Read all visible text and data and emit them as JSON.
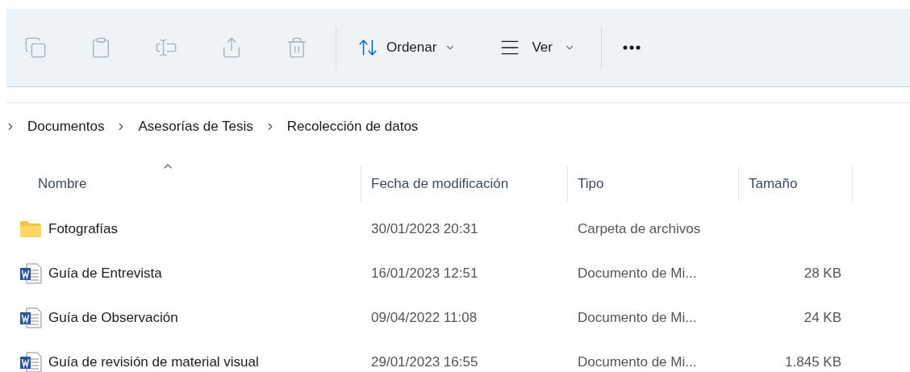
{
  "toolbar": {
    "actions": [
      {
        "kind": "copy",
        "disabled": true
      },
      {
        "kind": "paste",
        "disabled": true
      },
      {
        "kind": "rename",
        "disabled": true
      },
      {
        "kind": "share",
        "disabled": true
      },
      {
        "kind": "delete",
        "disabled": true
      }
    ],
    "sort_button": {
      "label": "Ordenar"
    },
    "view_button": {
      "label": "Ver"
    }
  },
  "breadcrumb": [
    "Documentos",
    "Asesorías de Tesis",
    "Recolección de datos"
  ],
  "table": {
    "columns": [
      {
        "label": "Nombre",
        "sorted": true
      },
      {
        "label": "Fecha de modificación",
        "sorted": false
      },
      {
        "label": "Tipo",
        "sorted": false
      },
      {
        "label": "Tamaño",
        "sorted": false
      }
    ],
    "rows": [
      {
        "kind": "folder",
        "name": "Fotografías",
        "date": "30/01/2023 20:31",
        "type": "Carpeta de archivos"
      },
      {
        "kind": "word",
        "name": "Guía de Entrevista",
        "date": "16/01/2023 12:51",
        "type": "Documento de Mi...",
        "size": "28 KB"
      },
      {
        "kind": "word",
        "name": "Guía de Observación",
        "date": "09/04/2022 11:08",
        "type": "Documento de Mi...",
        "size": "24 KB"
      },
      {
        "kind": "word",
        "name": "Guía de revisión de material visual",
        "date": "29/01/2023 16:55",
        "type": "Documento de Mi...",
        "size": "1.845 KB"
      }
    ]
  }
}
